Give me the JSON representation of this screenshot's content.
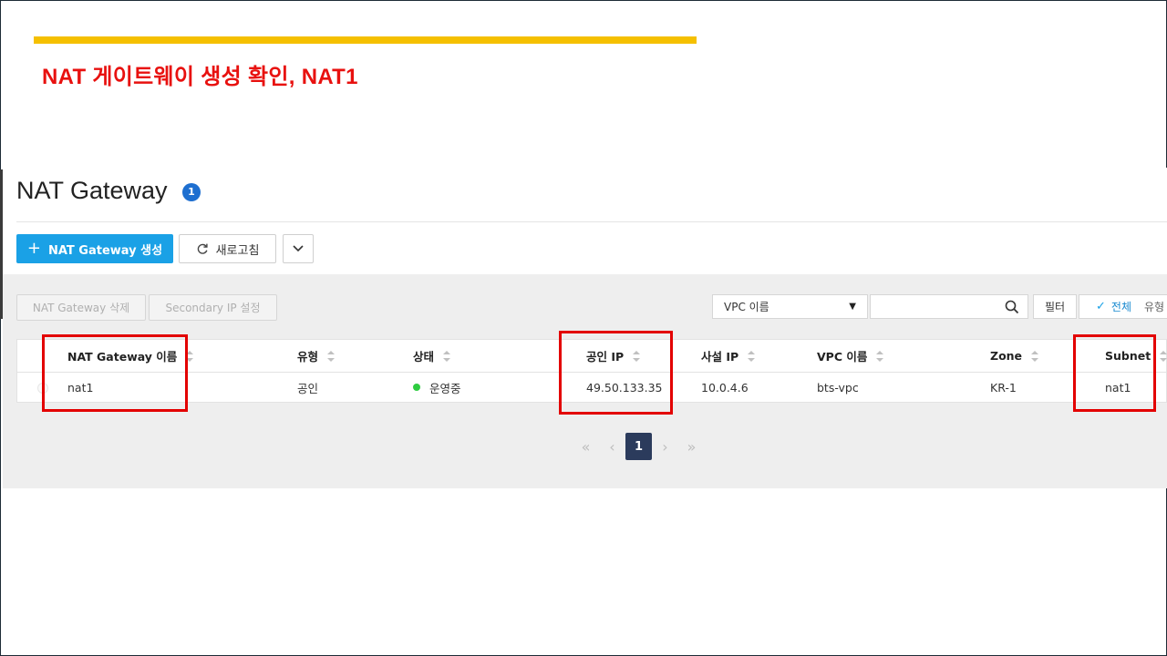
{
  "slide": {
    "title": "NAT 게이트웨이 생성 확인, NAT1",
    "accent_color": "#f5c000",
    "title_color": "#e8110f"
  },
  "console": {
    "page_title": "NAT Gateway",
    "count": "1",
    "toolbar": {
      "create_label": "NAT Gateway 생성",
      "refresh_label": "새로고침",
      "more_icon": "chevron-down-icon"
    },
    "actions": {
      "delete_label": "NAT Gateway 삭제",
      "secondary_ip_label": "Secondary IP 설정"
    },
    "filter": {
      "select_value": "VPC 이름",
      "search_value": "",
      "filter_label": "필터",
      "chip_active": "전체",
      "chip_other": "유형"
    },
    "table": {
      "columns": [
        "NAT Gateway 이름",
        "유형",
        "상태",
        "공인 IP",
        "사설 IP",
        "VPC 이름",
        "Zone",
        "Subnet"
      ],
      "rows": [
        {
          "name": "nat1",
          "type": "공인",
          "status": "운영중",
          "public_ip": "49.50.133.35",
          "private_ip": "10.0.4.6",
          "vpc": "bts-vpc",
          "zone": "KR-1",
          "subnet": "nat1"
        }
      ]
    },
    "pagination": {
      "first": "«",
      "prev": "‹",
      "current": "1",
      "next": "›",
      "last": "»"
    },
    "colors": {
      "primary": "#1aa1e6",
      "badge": "#1e6fd0",
      "status_running": "#2ecc40",
      "pagination_active": "#2b3b5c",
      "highlight": "#e30000"
    }
  }
}
